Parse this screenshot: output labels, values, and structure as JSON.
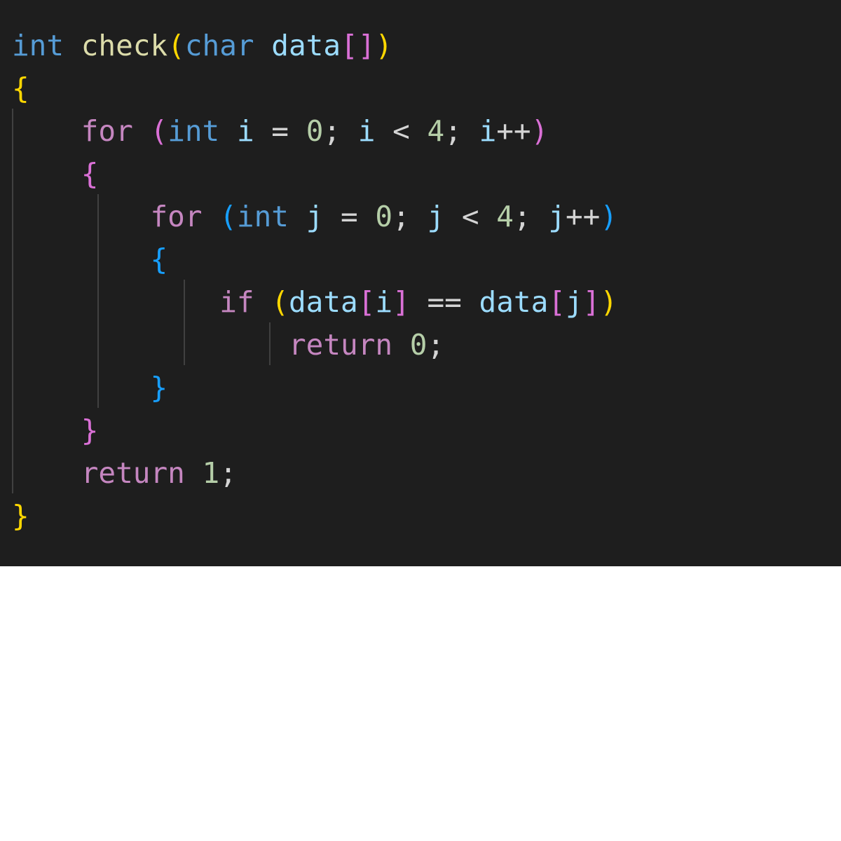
{
  "colors": {
    "background": "#1e1e1e",
    "plain": "#d4d4d4",
    "keyword_type": "#569cd6",
    "control": "#c586c0",
    "function": "#dcdcaa",
    "variable": "#9cdcfe",
    "number": "#b5cea8",
    "bracket": "#ffd700",
    "paren": "#da70d6",
    "paren2": "#179fff"
  },
  "code_lines": [
    [
      {
        "text": "int",
        "color": "keyword_type"
      },
      {
        "text": " ",
        "color": "plain"
      },
      {
        "text": "check",
        "color": "function"
      },
      {
        "text": "(",
        "color": "bracket"
      },
      {
        "text": "char",
        "color": "keyword_type"
      },
      {
        "text": " ",
        "color": "plain"
      },
      {
        "text": "data",
        "color": "variable"
      },
      {
        "text": "[]",
        "color": "paren"
      },
      {
        "text": ")",
        "color": "bracket"
      }
    ],
    [
      {
        "text": "{",
        "color": "bracket"
      }
    ],
    [
      {
        "text": "    ",
        "color": "plain"
      },
      {
        "text": "for",
        "color": "control"
      },
      {
        "text": " ",
        "color": "plain"
      },
      {
        "text": "(",
        "color": "paren"
      },
      {
        "text": "int",
        "color": "keyword_type"
      },
      {
        "text": " ",
        "color": "plain"
      },
      {
        "text": "i",
        "color": "variable"
      },
      {
        "text": " = ",
        "color": "plain"
      },
      {
        "text": "0",
        "color": "number"
      },
      {
        "text": "; ",
        "color": "plain"
      },
      {
        "text": "i",
        "color": "variable"
      },
      {
        "text": " < ",
        "color": "plain"
      },
      {
        "text": "4",
        "color": "number"
      },
      {
        "text": "; ",
        "color": "plain"
      },
      {
        "text": "i",
        "color": "variable"
      },
      {
        "text": "++",
        "color": "plain"
      },
      {
        "text": ")",
        "color": "paren"
      }
    ],
    [
      {
        "text": "    ",
        "color": "plain"
      },
      {
        "text": "{",
        "color": "paren"
      }
    ],
    [
      {
        "text": "        ",
        "color": "plain"
      },
      {
        "text": "for",
        "color": "control"
      },
      {
        "text": " ",
        "color": "plain"
      },
      {
        "text": "(",
        "color": "paren2"
      },
      {
        "text": "int",
        "color": "keyword_type"
      },
      {
        "text": " ",
        "color": "plain"
      },
      {
        "text": "j",
        "color": "variable"
      },
      {
        "text": " = ",
        "color": "plain"
      },
      {
        "text": "0",
        "color": "number"
      },
      {
        "text": "; ",
        "color": "plain"
      },
      {
        "text": "j",
        "color": "variable"
      },
      {
        "text": " < ",
        "color": "plain"
      },
      {
        "text": "4",
        "color": "number"
      },
      {
        "text": "; ",
        "color": "plain"
      },
      {
        "text": "j",
        "color": "variable"
      },
      {
        "text": "++",
        "color": "plain"
      },
      {
        "text": ")",
        "color": "paren2"
      }
    ],
    [
      {
        "text": "        ",
        "color": "plain"
      },
      {
        "text": "{",
        "color": "paren2"
      }
    ],
    [
      {
        "text": "            ",
        "color": "plain"
      },
      {
        "text": "if",
        "color": "control"
      },
      {
        "text": " ",
        "color": "plain"
      },
      {
        "text": "(",
        "color": "bracket"
      },
      {
        "text": "data",
        "color": "variable"
      },
      {
        "text": "[",
        "color": "paren"
      },
      {
        "text": "i",
        "color": "variable"
      },
      {
        "text": "]",
        "color": "paren"
      },
      {
        "text": " == ",
        "color": "plain"
      },
      {
        "text": "data",
        "color": "variable"
      },
      {
        "text": "[",
        "color": "paren"
      },
      {
        "text": "j",
        "color": "variable"
      },
      {
        "text": "]",
        "color": "paren"
      },
      {
        "text": ")",
        "color": "bracket"
      }
    ],
    [
      {
        "text": "                ",
        "color": "plain"
      },
      {
        "text": "return",
        "color": "control"
      },
      {
        "text": " ",
        "color": "plain"
      },
      {
        "text": "0",
        "color": "number"
      },
      {
        "text": ";",
        "color": "plain"
      }
    ],
    [
      {
        "text": "        ",
        "color": "plain"
      },
      {
        "text": "}",
        "color": "paren2"
      }
    ],
    [
      {
        "text": "    ",
        "color": "plain"
      },
      {
        "text": "}",
        "color": "paren"
      }
    ],
    [
      {
        "text": "    ",
        "color": "plain"
      },
      {
        "text": "return",
        "color": "control"
      },
      {
        "text": " ",
        "color": "plain"
      },
      {
        "text": "1",
        "color": "number"
      },
      {
        "text": ";",
        "color": "plain"
      }
    ],
    [
      {
        "text": "}",
        "color": "bracket"
      }
    ]
  ]
}
